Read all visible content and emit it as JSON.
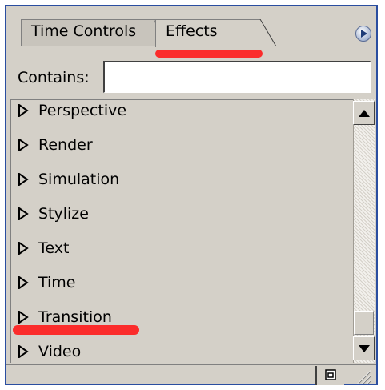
{
  "tabs": [
    {
      "label": "Time Controls",
      "active": false
    },
    {
      "label": "Effects",
      "active": true
    }
  ],
  "panel_menu_icon": "panel-menu-arrow-icon",
  "contains": {
    "label": "Contains:",
    "value": ""
  },
  "effects_list": [
    {
      "label": "Perspective",
      "expanded": false
    },
    {
      "label": "Render",
      "expanded": false
    },
    {
      "label": "Simulation",
      "expanded": false
    },
    {
      "label": "Stylize",
      "expanded": false
    },
    {
      "label": "Text",
      "expanded": false
    },
    {
      "label": "Time",
      "expanded": false
    },
    {
      "label": "Transition",
      "expanded": false
    },
    {
      "label": "Video",
      "expanded": false
    }
  ],
  "colors": {
    "panel_bg": "#d4d0c8",
    "border_blue": "#2a4ea0",
    "highlight_red": "#ff1a1a"
  },
  "icons": {
    "expand": "disclosure-triangle-icon",
    "scroll_up": "scroll-up-arrow-icon",
    "scroll_down": "scroll-down-arrow-icon",
    "new_bin": "new-bin-icon",
    "resize": "resize-grip-icon"
  }
}
